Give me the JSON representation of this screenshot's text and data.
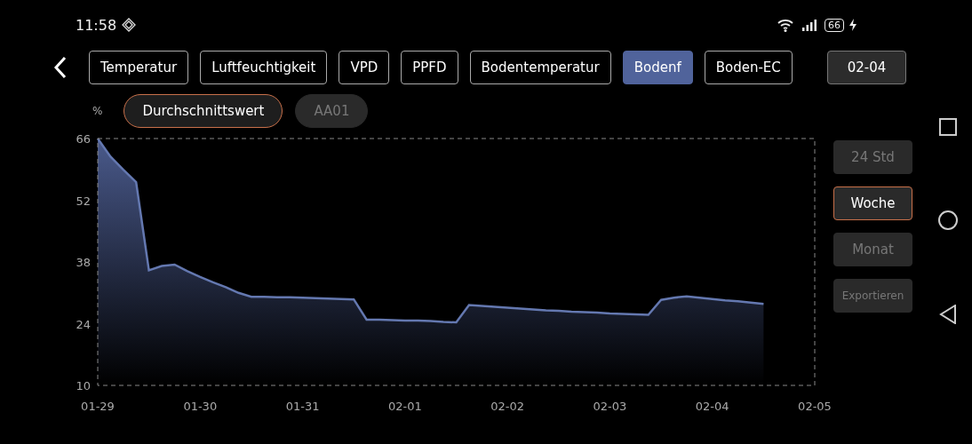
{
  "status_bar": {
    "time": "11:58",
    "battery": "66"
  },
  "tabs": [
    {
      "label": "Temperatur",
      "selected": false
    },
    {
      "label": "Luftfeuchtigkeit",
      "selected": false
    },
    {
      "label": "VPD",
      "selected": false
    },
    {
      "label": "PPFD",
      "selected": false
    },
    {
      "label": "Bodentemperatur",
      "selected": false
    },
    {
      "label": "Bodenf",
      "selected": true
    },
    {
      "label": "Boden-EC",
      "selected": false
    }
  ],
  "date_button": "02-04",
  "unit": "%",
  "sources": [
    {
      "label": "Durchschnittswert",
      "selected": true
    },
    {
      "label": "AA01",
      "selected": false
    }
  ],
  "ranges": [
    {
      "label": "24 Std",
      "selected": false
    },
    {
      "label": "Woche",
      "selected": true
    },
    {
      "label": "Monat",
      "selected": false
    }
  ],
  "export_button": "Exportieren",
  "chart_data": {
    "type": "area",
    "categories": [
      "01-29",
      null,
      null,
      null,
      null,
      null,
      null,
      null,
      "01-30",
      null,
      null,
      null,
      null,
      null,
      null,
      null,
      "01-31",
      null,
      null,
      null,
      null,
      null,
      null,
      null,
      "02-01",
      null,
      null,
      null,
      null,
      null,
      null,
      null,
      "02-02",
      null,
      null,
      null,
      null,
      null,
      null,
      null,
      "02-03",
      null,
      null,
      null,
      null,
      null,
      null,
      null,
      "02-04",
      null,
      null,
      null,
      null,
      null,
      null,
      null,
      "02-05"
    ],
    "series": [
      {
        "color": "#6478b0",
        "values": [
          66,
          61.9,
          58.9,
          56.1,
          36.1,
          37.1,
          37.4,
          35.9,
          34.6,
          33.4,
          32.3,
          31.0,
          30.1,
          30.1,
          30.0,
          30.0,
          29.9,
          29.8,
          29.7,
          29.6,
          29.5,
          24.9,
          24.9,
          24.8,
          24.7,
          24.7,
          24.6,
          24.4,
          24.3,
          28.2,
          28.0,
          27.8,
          27.6,
          27.4,
          27.2,
          27.0,
          26.9,
          26.7,
          26.6,
          26.5,
          26.3,
          26.2,
          26.1,
          26.0,
          29.4,
          29.9,
          30.2,
          29.9,
          29.6,
          29.3,
          29.1,
          28.8,
          28.5,
          null,
          null,
          null,
          null
        ]
      }
    ],
    "ylim": [
      10,
      66
    ],
    "yticks": [
      10,
      24,
      38,
      52,
      66
    ]
  }
}
